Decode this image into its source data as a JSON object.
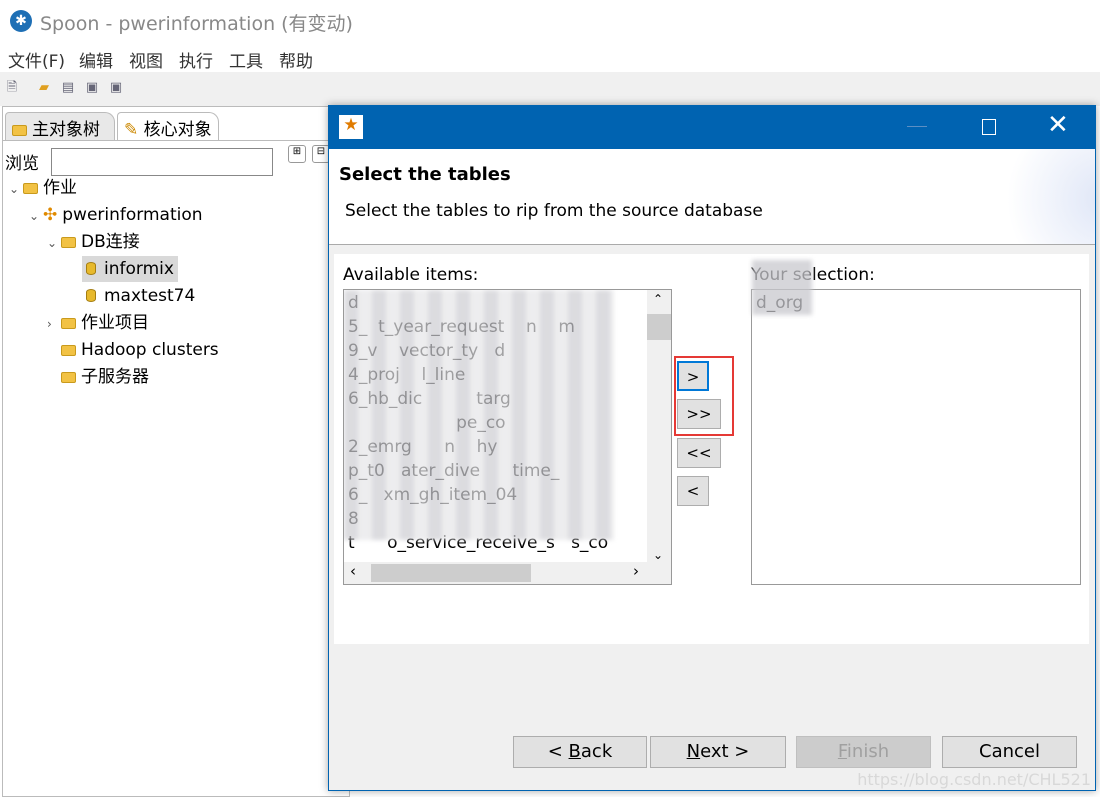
{
  "app": {
    "title": "Spoon - pwerinformation (有变动)",
    "icon": "spoon-logo"
  },
  "menu": [
    "文件(F)",
    "编辑",
    "视图",
    "执行",
    "工具",
    "帮助"
  ],
  "toolbar_icons": [
    "new-file-icon",
    "open-folder-icon",
    "explore-icon",
    "save-icon",
    "save-as-icon"
  ],
  "left": {
    "tabs": [
      {
        "label": "主对象树",
        "icon": "magnifier-folder-icon"
      },
      {
        "label": "核心对象",
        "icon": "pencil-icon"
      }
    ],
    "browse_label": "浏览",
    "browse_value": "",
    "tree": [
      {
        "label": "作业",
        "level": 0,
        "expanded": true,
        "icon": "folder-icon"
      },
      {
        "label": "pwerinformation",
        "level": 1,
        "expanded": true,
        "icon": "job-icon"
      },
      {
        "label": "DB连接",
        "level": 2,
        "expanded": true,
        "icon": "folder-icon"
      },
      {
        "label": "informix",
        "level": 3,
        "selected": true,
        "icon": "database-icon"
      },
      {
        "label": "maxtest74",
        "level": 3,
        "icon": "database-icon"
      },
      {
        "label": "作业项目",
        "level": 2,
        "expanded": false,
        "icon": "folder-icon"
      },
      {
        "label": "Hadoop clusters",
        "level": 2,
        "icon": "folder-icon"
      },
      {
        "label": "子服务器",
        "level": 2,
        "icon": "folder-icon"
      }
    ]
  },
  "dialog": {
    "title_icon": "wizard-wand-icon",
    "heading": "Select the tables",
    "subheading": "Select the tables to rip from the source database",
    "available_label": "Available items:",
    "available_items": [
      "d",
      "5_  t_year_request    n    m",
      "9_v    vector_ty   d",
      "4_proj    l_line",
      "6_hb_dic          targ",
      "                    pe_co",
      "2_emrg      n    hy",
      "p_t0   ater_dive      time_",
      "6_   xm_gh_item_04",
      "8",
      "t      o_service_receive_s   s_co"
    ],
    "selection_label": "Your selection:",
    "selection_items": [
      "    d_org"
    ],
    "move_buttons": [
      ">",
      ">>",
      "<<",
      "<"
    ],
    "buttons": {
      "back": {
        "pre": "< ",
        "u": "B",
        "post": "ack"
      },
      "next": {
        "pre": "",
        "u": "N",
        "post": "ext >"
      },
      "finish": {
        "pre": "",
        "u": "F",
        "post": "inish",
        "disabled": true
      },
      "cancel": "Cancel"
    },
    "watermark": "https://blog.csdn.net/CHL521",
    "highlight_color": "#e53935",
    "titlebar_color": "#0063b1"
  }
}
